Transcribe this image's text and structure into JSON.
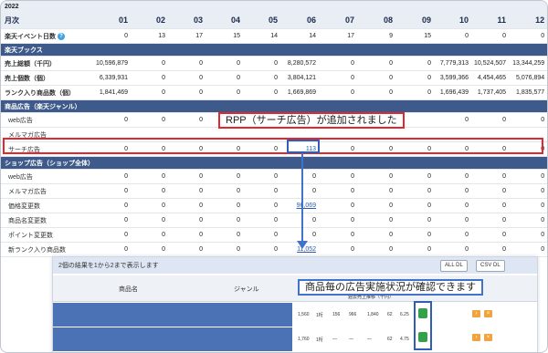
{
  "year": "2022",
  "months_label": "月次",
  "months": [
    "01",
    "02",
    "03",
    "04",
    "05",
    "06",
    "07",
    "08",
    "09",
    "10",
    "11",
    "12"
  ],
  "rows": [
    {
      "type": "data",
      "label": "楽天イベント日数",
      "help": "?",
      "values": [
        "0",
        "13",
        "17",
        "15",
        "14",
        "14",
        "17",
        "9",
        "15",
        "0",
        "0",
        "0"
      ]
    },
    {
      "type": "section",
      "label": "楽天ブックス"
    },
    {
      "type": "data",
      "label": "売上総額（千円）",
      "values": [
        "10,596,879",
        "0",
        "0",
        "0",
        "0",
        "8,280,572",
        "0",
        "0",
        "0",
        "7,779,313",
        "10,524,507",
        "13,344,259"
      ]
    },
    {
      "type": "data",
      "label": "売上個数（個）",
      "values": [
        "6,339,931",
        "0",
        "0",
        "0",
        "0",
        "3,804,121",
        "0",
        "0",
        "0",
        "3,599,366",
        "4,454,465",
        "5,076,894"
      ]
    },
    {
      "type": "data",
      "label": "ランク入り商品数（個）",
      "values": [
        "1,841,469",
        "0",
        "0",
        "0",
        "0",
        "1,669,869",
        "0",
        "0",
        "0",
        "1,696,439",
        "1,737,405",
        "1,835,577"
      ]
    },
    {
      "type": "section",
      "label": "商品広告（楽天ジャンル）"
    },
    {
      "type": "sub",
      "label": "web広告",
      "values": [
        "0",
        "0",
        "0",
        "0",
        "0",
        "",
        "",
        "",
        "",
        "0",
        "0",
        "0"
      ]
    },
    {
      "type": "sub",
      "label": "メルマガ広告",
      "values": [
        "",
        "",
        "",
        "",
        "",
        "",
        "",
        "",
        "",
        "",
        "",
        ""
      ]
    },
    {
      "type": "sub",
      "label": "サーチ広告",
      "values": [
        "0",
        "0",
        "0",
        "0",
        "0",
        "113",
        "0",
        "0",
        "0",
        "0",
        "0",
        "0"
      ],
      "highlight": true
    },
    {
      "type": "section",
      "label": "ショップ広告（ショップ全体）"
    },
    {
      "type": "sub",
      "label": "web広告",
      "values": [
        "0",
        "0",
        "0",
        "0",
        "0",
        "0",
        "0",
        "0",
        "0",
        "0",
        "0",
        "0"
      ]
    },
    {
      "type": "sub",
      "label": "メルマガ広告",
      "values": [
        "0",
        "0",
        "0",
        "0",
        "0",
        "0",
        "0",
        "0",
        "0",
        "0",
        "0",
        "0"
      ]
    },
    {
      "type": "sub",
      "label": "価格変更数",
      "values": [
        "0",
        "0",
        "0",
        "0",
        "0",
        "96,069",
        "0",
        "0",
        "0",
        "0",
        "0",
        "0"
      ]
    },
    {
      "type": "sub",
      "label": "商品名変更数",
      "values": [
        "0",
        "0",
        "0",
        "0",
        "0",
        "0",
        "0",
        "0",
        "0",
        "0",
        "0",
        "0"
      ]
    },
    {
      "type": "sub",
      "label": "ポイント変更数",
      "values": [
        "0",
        "0",
        "0",
        "0",
        "0",
        "0",
        "0",
        "0",
        "0",
        "0",
        "0",
        "0"
      ]
    },
    {
      "type": "sub",
      "label": "新ランク入り商品数",
      "values": [
        "0",
        "0",
        "0",
        "0",
        "0",
        "11,052",
        "0",
        "0",
        "0",
        "0",
        "0",
        "0"
      ]
    }
  ],
  "callout_rpp": "RPP（サーチ広告）が追加されました",
  "callout_ads": "商品毎の広告実施状況が確認できます",
  "inset": {
    "count_text": "2個の結果を1から2まで表示します",
    "btn_all": "ALL DL",
    "btn_csv": "CSV DL",
    "col_product": "商品名",
    "col_genre": "ジャンル",
    "col_sales": "過去売上推移（千円）",
    "rows": [
      [
        "1,560",
        "1桁",
        "156",
        "966",
        "1,840",
        "62",
        "6.25"
      ],
      [
        "1,760",
        "1桁",
        "—",
        "—",
        "—",
        "62",
        "4.75"
      ]
    ]
  },
  "colors": {
    "header_bg": "#e9eef5",
    "section_bg": "#3d5a8a",
    "highlight_red": "#e0282e",
    "highlight_blue": "#2f5eb5",
    "link": "#2a5db0",
    "cart_green": "#33a04a",
    "action_orange": "#f3a33c"
  }
}
